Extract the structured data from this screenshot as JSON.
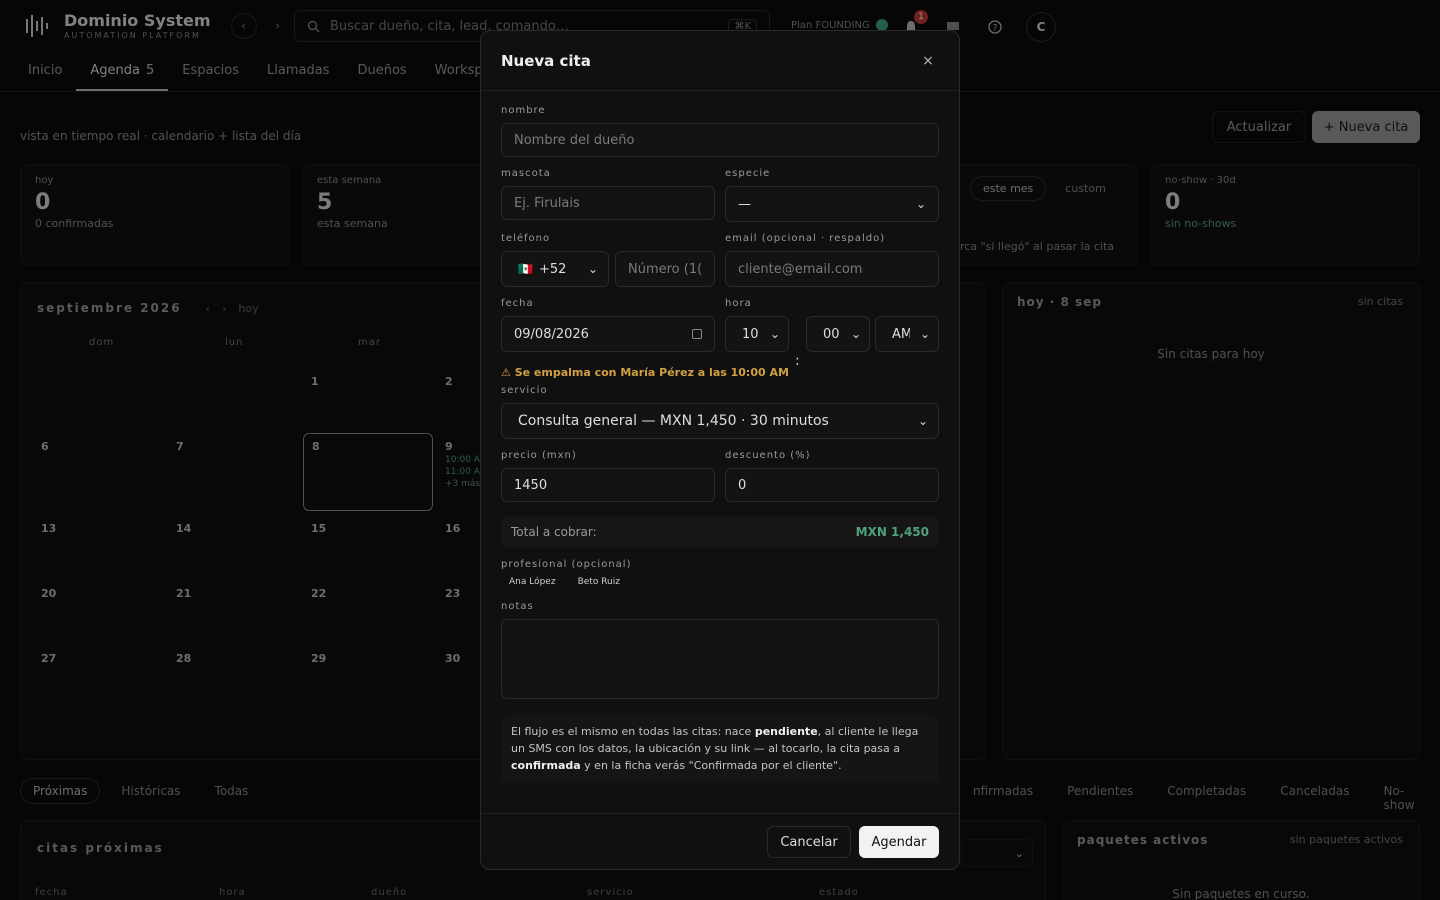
{
  "app": {
    "title": "Dominio System",
    "subtitle": "AUTOMATION PLATFORM"
  },
  "search": {
    "placeholder": "Buscar dueño, cita, lead, comando…",
    "shortcut": "⌘K"
  },
  "plan": {
    "label": "Plan FOUNDING"
  },
  "notifications": {
    "count": "1"
  },
  "user": {
    "initial": "C"
  },
  "nav": {
    "tabs": [
      {
        "label": "Inicio",
        "count": ""
      },
      {
        "label": "Agenda",
        "count": "5"
      },
      {
        "label": "Espacios",
        "count": ""
      },
      {
        "label": "Llamadas",
        "count": ""
      },
      {
        "label": "Dueños",
        "count": ""
      },
      {
        "label": "Workspa",
        "count": ""
      }
    ]
  },
  "page": {
    "subtitle": "vista en tiempo real · calendario + lista del día",
    "refresh_label": "Actualizar",
    "new_label": "+ Nueva cita"
  },
  "stats": [
    {
      "label": "hoy",
      "value": "0",
      "sub": "0 confirmadas"
    },
    {
      "label": "esta semana",
      "value": "5",
      "sub": "esta semana"
    },
    {
      "label": "no-show · 30d",
      "value": "0",
      "sub": "sin no-shows"
    }
  ],
  "range": {
    "this_month": "este mes",
    "custom": "custom",
    "hint": "rca \"si llegó\" al pasar la cita"
  },
  "calendar": {
    "month": "septiembre 2026",
    "prev": "‹",
    "next": "›",
    "today": "hoy",
    "dow": [
      "dom",
      "lun",
      "mar"
    ],
    "days": [
      "1",
      "2",
      "6",
      "7",
      "8",
      "9",
      "13",
      "14",
      "15",
      "16",
      "20",
      "21",
      "22",
      "23",
      "27",
      "28",
      "29",
      "30"
    ],
    "events": [
      "10:00 A",
      "11:00 A",
      "+3 más"
    ]
  },
  "day_panel": {
    "title": "hoy · 8 sep",
    "status": "sin citas",
    "empty": "Sin citas para hoy"
  },
  "list_filters": {
    "left": [
      "Próximas",
      "Históricas",
      "Todas"
    ],
    "right": [
      "nfirmadas",
      "Pendientes",
      "Completadas",
      "Canceladas",
      "No-show"
    ]
  },
  "upcoming": {
    "title": "citas próximas",
    "columns": [
      "fecha",
      "hora",
      "dueño",
      "servicio",
      "estado"
    ]
  },
  "packages": {
    "title": "paquetes activos",
    "status": "sin paquetes activos",
    "empty": "Sin paquetes en curso."
  },
  "modal": {
    "title": "Nueva cita",
    "close": "×",
    "labels": {
      "nombre": "nombre",
      "mascota": "mascota",
      "especie": "especie",
      "telefono": "teléfono",
      "email": "email (opcional · respaldo)",
      "fecha": "fecha",
      "hora": "hora",
      "servicio": "servicio",
      "precio": "precio (mxn)",
      "descuento": "descuento (%)",
      "profesional": "profesional (opcional)",
      "notas": "notas"
    },
    "nombre_placeholder": "Nombre del dueño",
    "mascota_placeholder": "Ej. Firulais",
    "especie_value": "—",
    "country_flag": "🇲🇽",
    "country_code": "+52",
    "phone_placeholder": "Número (1(",
    "email_placeholder": "cliente@email.com",
    "fecha_value": "09/08/2026",
    "hour": "10",
    "minute": "00",
    "ampm": "AM",
    "colon": ":",
    "warning": "⚠ Se empalma con María Pérez a las 10:00 AM",
    "servicio_value": "Consulta general — MXN 1,450 · 30 minutos",
    "precio_value": "1450",
    "descuento_value": "0",
    "total_label": "Total a cobrar:",
    "total_value": "MXN 1,450",
    "profesionales": [
      "Ana López",
      "Beto Ruiz"
    ],
    "info": {
      "p1": "El flujo es el mismo en todas las citas: nace ",
      "b1": "pendiente",
      "p2": ", al cliente le llega un SMS con los datos, la ubicación y su link — al tocarlo, la cita pasa a ",
      "b2": "confirmada",
      "p3": " y en la ficha verás \"Confirmada por el cliente\"."
    },
    "cancel_label": "Cancelar",
    "submit_label": "Agendar"
  }
}
